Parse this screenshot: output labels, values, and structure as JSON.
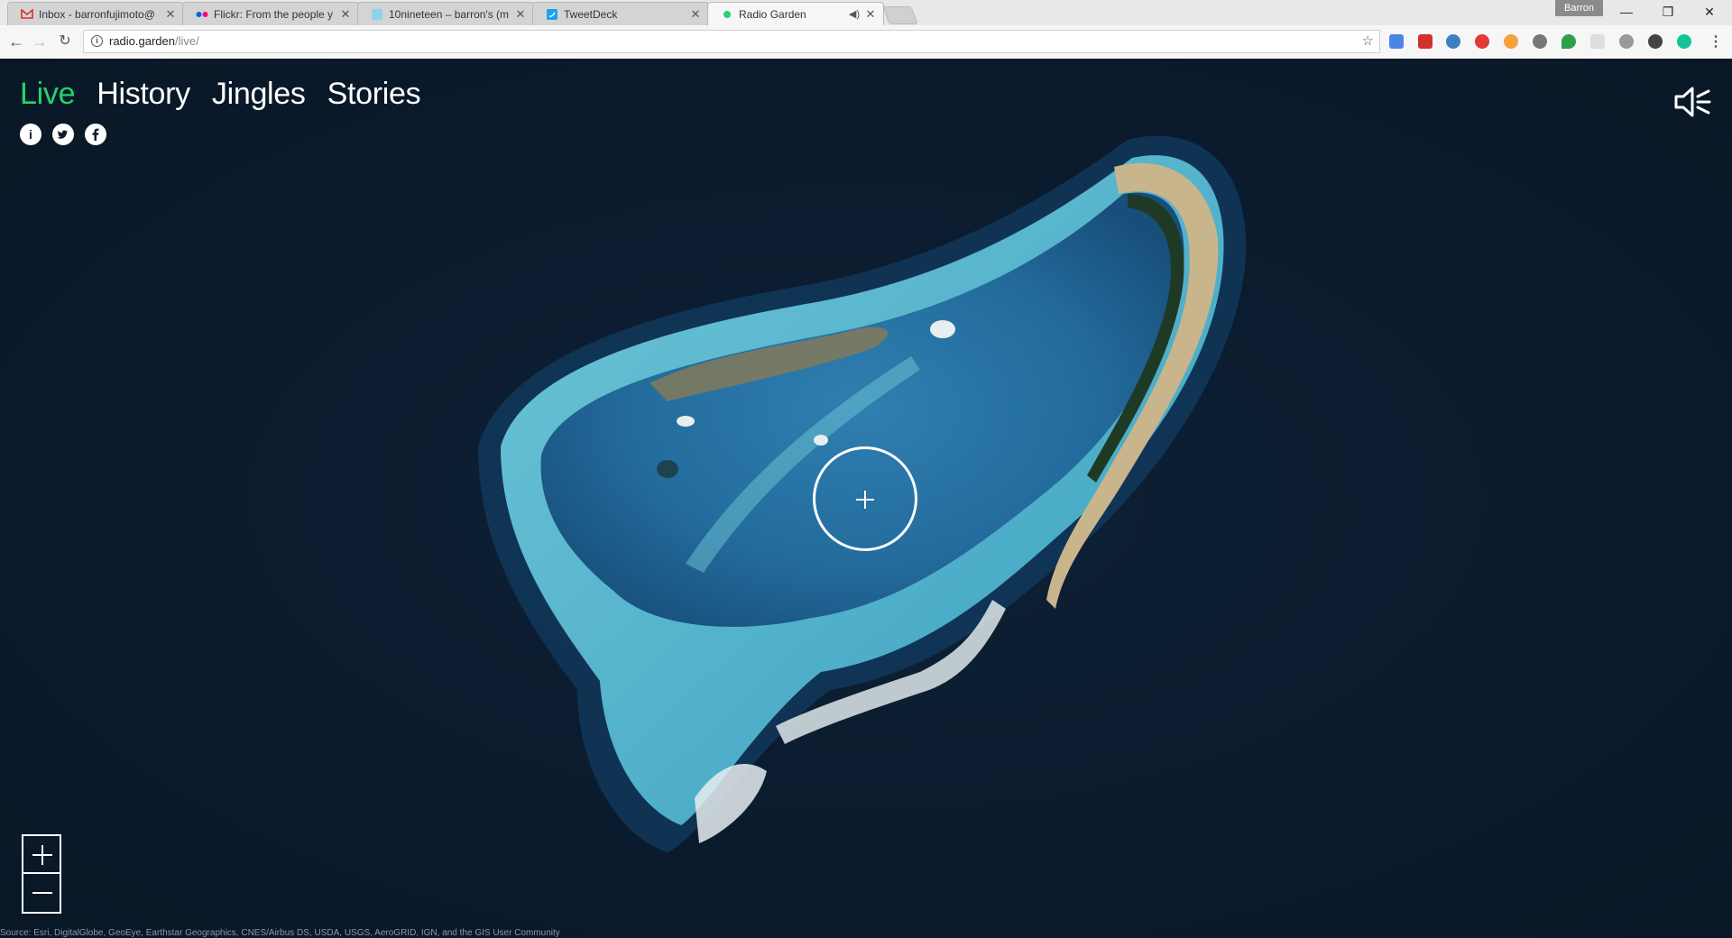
{
  "browser": {
    "tabs": [
      {
        "title": "Inbox - barronfujimoto@",
        "icon": "gmail-icon",
        "active": false
      },
      {
        "title": "Flickr: From the people y",
        "icon": "flickr-icon",
        "active": false
      },
      {
        "title": "10nineteen – barron's (m",
        "icon": "tumblr-icon",
        "active": false
      },
      {
        "title": "TweetDeck",
        "icon": "tweetdeck-icon",
        "active": false
      },
      {
        "title": "Radio Garden",
        "icon": "radio-garden-icon",
        "active": true,
        "audio": true
      }
    ],
    "profile_name": "Barron",
    "url_host": "radio.garden",
    "url_path": "/live/"
  },
  "page": {
    "nav": {
      "live": "Live",
      "history": "History",
      "jingles": "Jingles",
      "stories": "Stories"
    },
    "social": {
      "info_glyph": "i",
      "twitter_glyph": "t",
      "facebook_glyph": "f"
    },
    "zoom": {
      "in": "+",
      "out": "−"
    },
    "attribution": "Source: Esri, DigitalGlobe, GeoEye, Earthstar Geographics, CNES/Airbus DS, USDA, USGS, AeroGRID, IGN, and the GIS User Community",
    "colors": {
      "accent": "#22d46b",
      "background": "#0b1b2e"
    }
  }
}
